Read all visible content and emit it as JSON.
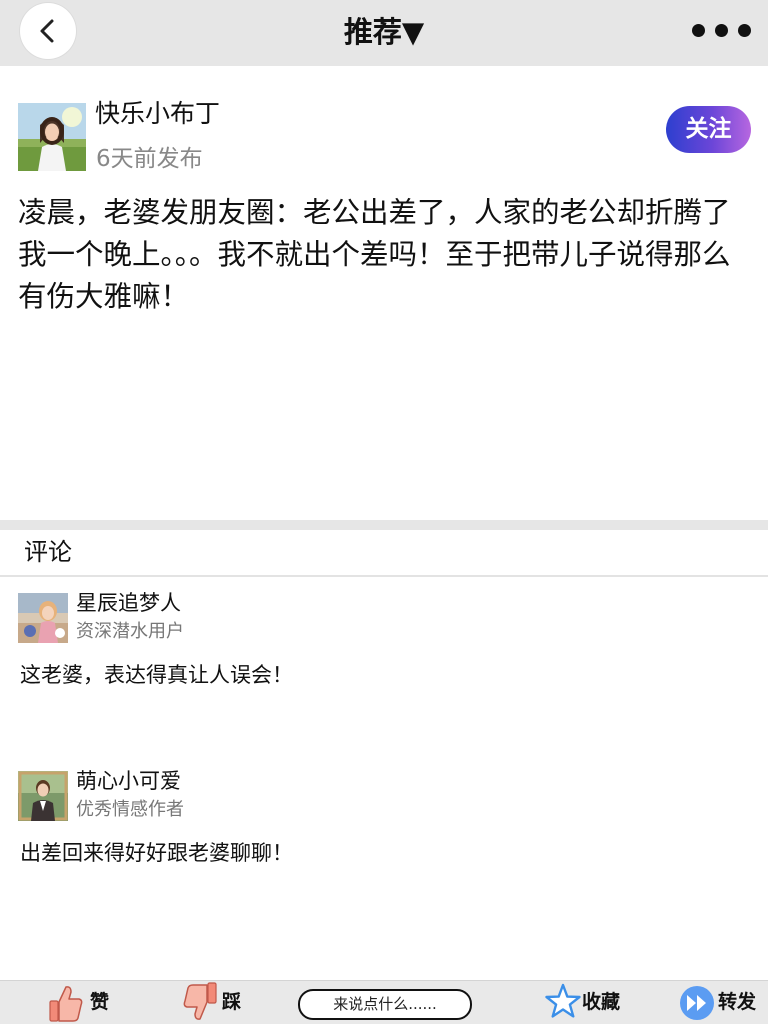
{
  "header": {
    "title": "推荐▼",
    "back_icon": "chevron-left-icon",
    "more_icon": "more-dots-icon",
    "background": "#e6e6e6"
  },
  "post": {
    "author_name": "快乐小布丁",
    "time": "6天前发布",
    "follow_label": "关注",
    "content": "凌晨，老婆发朋友圈：老公出差了，人家的老公却折腾了我一个晚上。。。我不就出个差吗！至于把带儿子说得那么有伤大雅嘛！"
  },
  "comments": {
    "title": "评论",
    "items": [
      {
        "name": "星辰追梦人",
        "role": "资深潜水用户",
        "text": "这老婆，表达得真让人误会！"
      },
      {
        "name": "萌心小可爱",
        "role": "优秀情感作者",
        "text": "出差回来得好好跟老婆聊聊！"
      }
    ]
  },
  "bottom_bar": {
    "like_label": "赞",
    "dislike_label": "踩",
    "comment_placeholder": "来说点什么......",
    "favorite_label": "收藏",
    "share_label": "转发",
    "icons": [
      "thumbs-up-icon",
      "thumbs-down-icon",
      "star-icon",
      "forward-icon"
    ]
  },
  "colors": {
    "follow_gradient_start": "#2d3fcf",
    "follow_gradient_end": "#b767e0",
    "thumb_color": "#f28a78",
    "star_color": "#3b8fe8",
    "forward_color": "#5b9cf2"
  }
}
